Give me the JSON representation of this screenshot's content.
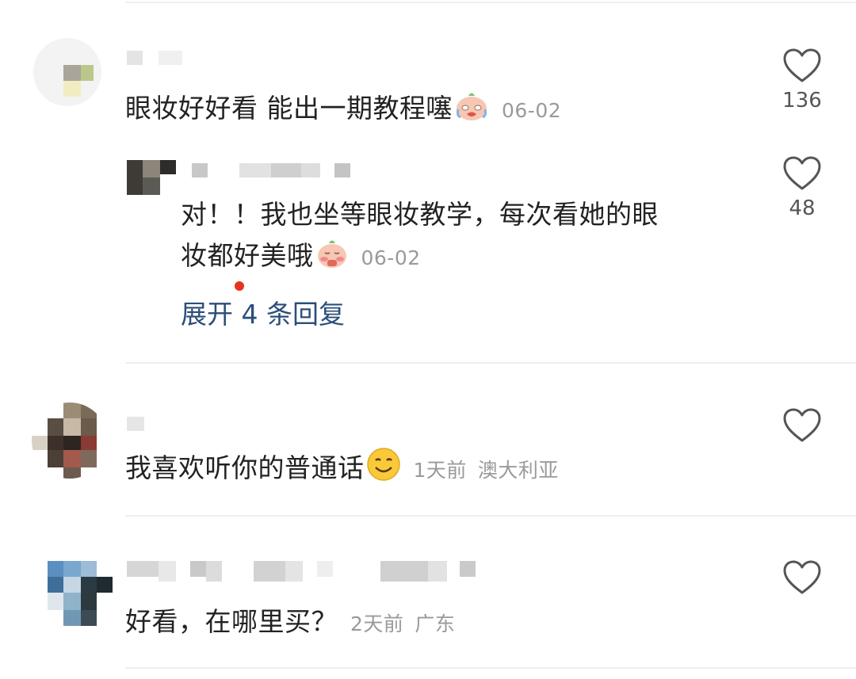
{
  "comments": [
    {
      "text": "眼妆好好看 能出一期教程噻",
      "emoji": "crying-face-emoji",
      "date": "06-02",
      "likes": "136",
      "reply": {
        "text_line1": "对！！我也坐等眼妆教学，每次看她的眼",
        "text_line2": "妆都好美哦",
        "emoji": "shy-face-emoji",
        "date": "06-02",
        "likes": "48"
      },
      "expand_label": "展开 4 条回复"
    },
    {
      "text": "我喜欢听你的普通话",
      "emoji": "smiling-face-emoji",
      "time": "1天前",
      "location": "澳大利亚"
    },
    {
      "text": "好看，在哪里买？",
      "time": "2天前",
      "location": "广东"
    }
  ],
  "colors": {
    "text": "#222222",
    "meta": "#9a9a9a",
    "link": "#2b4e7a",
    "badge": "#e8341c",
    "heart": "#555555"
  }
}
